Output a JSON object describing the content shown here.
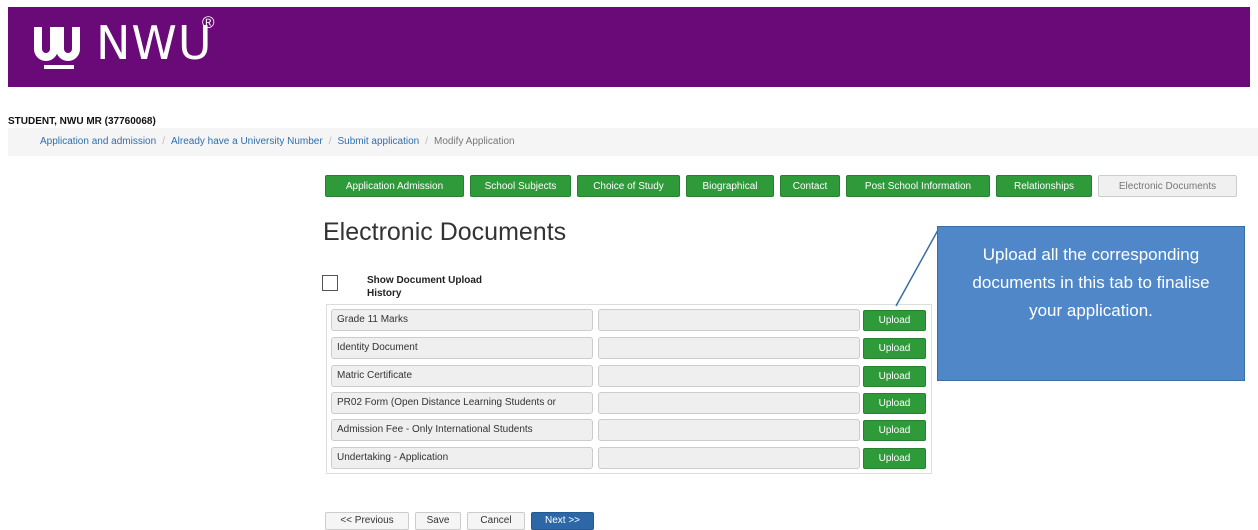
{
  "brand": {
    "logo_text": "NWU",
    "registered_mark": "®",
    "banner_color": "#6a0a78",
    "logo_icon": "nwu-emblem-icon"
  },
  "student": {
    "label": "STUDENT, NWU MR (37760068)"
  },
  "breadcrumb": {
    "items": [
      "Application and admission",
      "Already have a University Number",
      "Submit application"
    ],
    "current": "Modify Application",
    "separator": "/"
  },
  "tabs": [
    {
      "label": "Application Admission",
      "state": "complete"
    },
    {
      "label": "School Subjects",
      "state": "complete"
    },
    {
      "label": "Choice of Study",
      "state": "complete"
    },
    {
      "label": "Biographical",
      "state": "complete"
    },
    {
      "label": "Contact",
      "state": "complete"
    },
    {
      "label": "Post School Information",
      "state": "complete"
    },
    {
      "label": "Relationships",
      "state": "complete"
    },
    {
      "label": "Electronic Documents",
      "state": "active"
    }
  ],
  "page": {
    "title": "Electronic Documents",
    "show_history_label": "Show Document Upload History",
    "show_history_checked": false
  },
  "documents": {
    "upload_label": "Upload",
    "rows": [
      {
        "name": "Grade 11 Marks",
        "file": ""
      },
      {
        "name": "Identity Document",
        "file": ""
      },
      {
        "name": "Matric Certificate",
        "file": ""
      },
      {
        "name": "PR02 Form (Open Distance Learning Students or",
        "file": ""
      },
      {
        "name": "Admission Fee - Only International Students",
        "file": ""
      },
      {
        "name": "Undertaking - Application",
        "file": ""
      }
    ]
  },
  "callout": {
    "text": "Upload all the corresponding documents in this tab to finalise your application."
  },
  "footer": {
    "previous_label": "<< Previous",
    "save_label": "Save",
    "cancel_label": "Cancel",
    "next_label": "Next >>"
  },
  "colors": {
    "green": "#2f9a39",
    "primary_blue": "#2c68a7",
    "callout_blue": "#4f87c8"
  }
}
